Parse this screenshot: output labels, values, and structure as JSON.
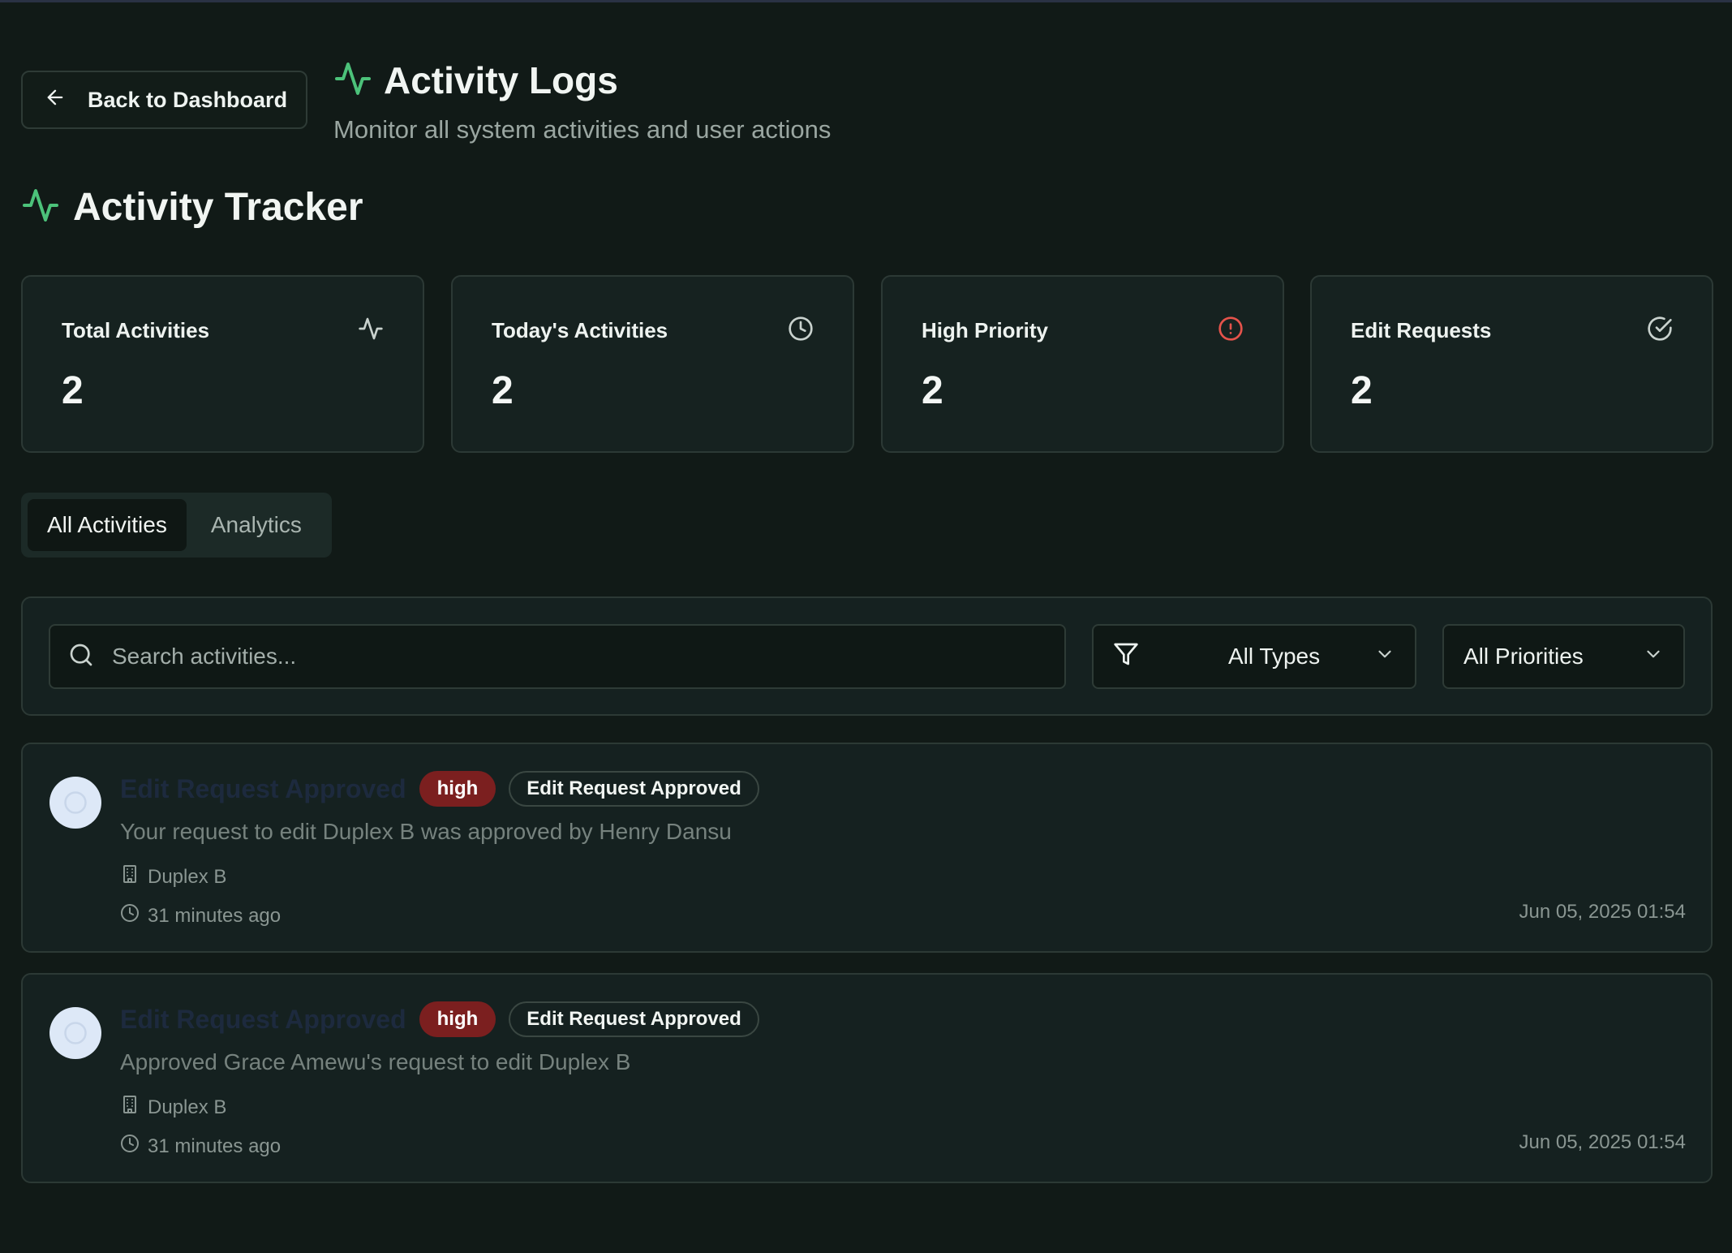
{
  "header": {
    "back_label": "Back to Dashboard",
    "title": "Activity Logs",
    "subtitle": "Monitor all system activities and user actions"
  },
  "tracker": {
    "title": "Activity Tracker"
  },
  "stats": [
    {
      "label": "Total Activities",
      "value": "2",
      "icon": "activity-icon"
    },
    {
      "label": "Today's Activities",
      "value": "2",
      "icon": "clock-icon"
    },
    {
      "label": "High Priority",
      "value": "2",
      "icon": "alert-circle-icon",
      "icon_color": "#e5534b"
    },
    {
      "label": "Edit Requests",
      "value": "2",
      "icon": "check-circle-icon"
    }
  ],
  "tabs": [
    {
      "label": "All Activities",
      "active": true
    },
    {
      "label": "Analytics",
      "active": false
    }
  ],
  "filters": {
    "search_placeholder": "Search activities...",
    "type_select": "All Types",
    "priority_select": "All Priorities"
  },
  "activities": [
    {
      "title": "Edit Request Approved",
      "priority": "high",
      "type": "Edit Request Approved",
      "description": "Your request to edit Duplex B was approved by Henry Dansu",
      "property": "Duplex B",
      "relative_time": "31 minutes ago",
      "timestamp": "Jun 05, 2025 01:54"
    },
    {
      "title": "Edit Request Approved",
      "priority": "high",
      "type": "Edit Request Approved",
      "description": "Approved Grace Amewu's request to edit Duplex B",
      "property": "Duplex B",
      "relative_time": "31 minutes ago",
      "timestamp": "Jun 05, 2025 01:54"
    }
  ],
  "colors": {
    "background": "#111a17",
    "accent_green": "#4cc27a",
    "priority_high": "#7b1f1f",
    "alert_red": "#e5534b"
  }
}
